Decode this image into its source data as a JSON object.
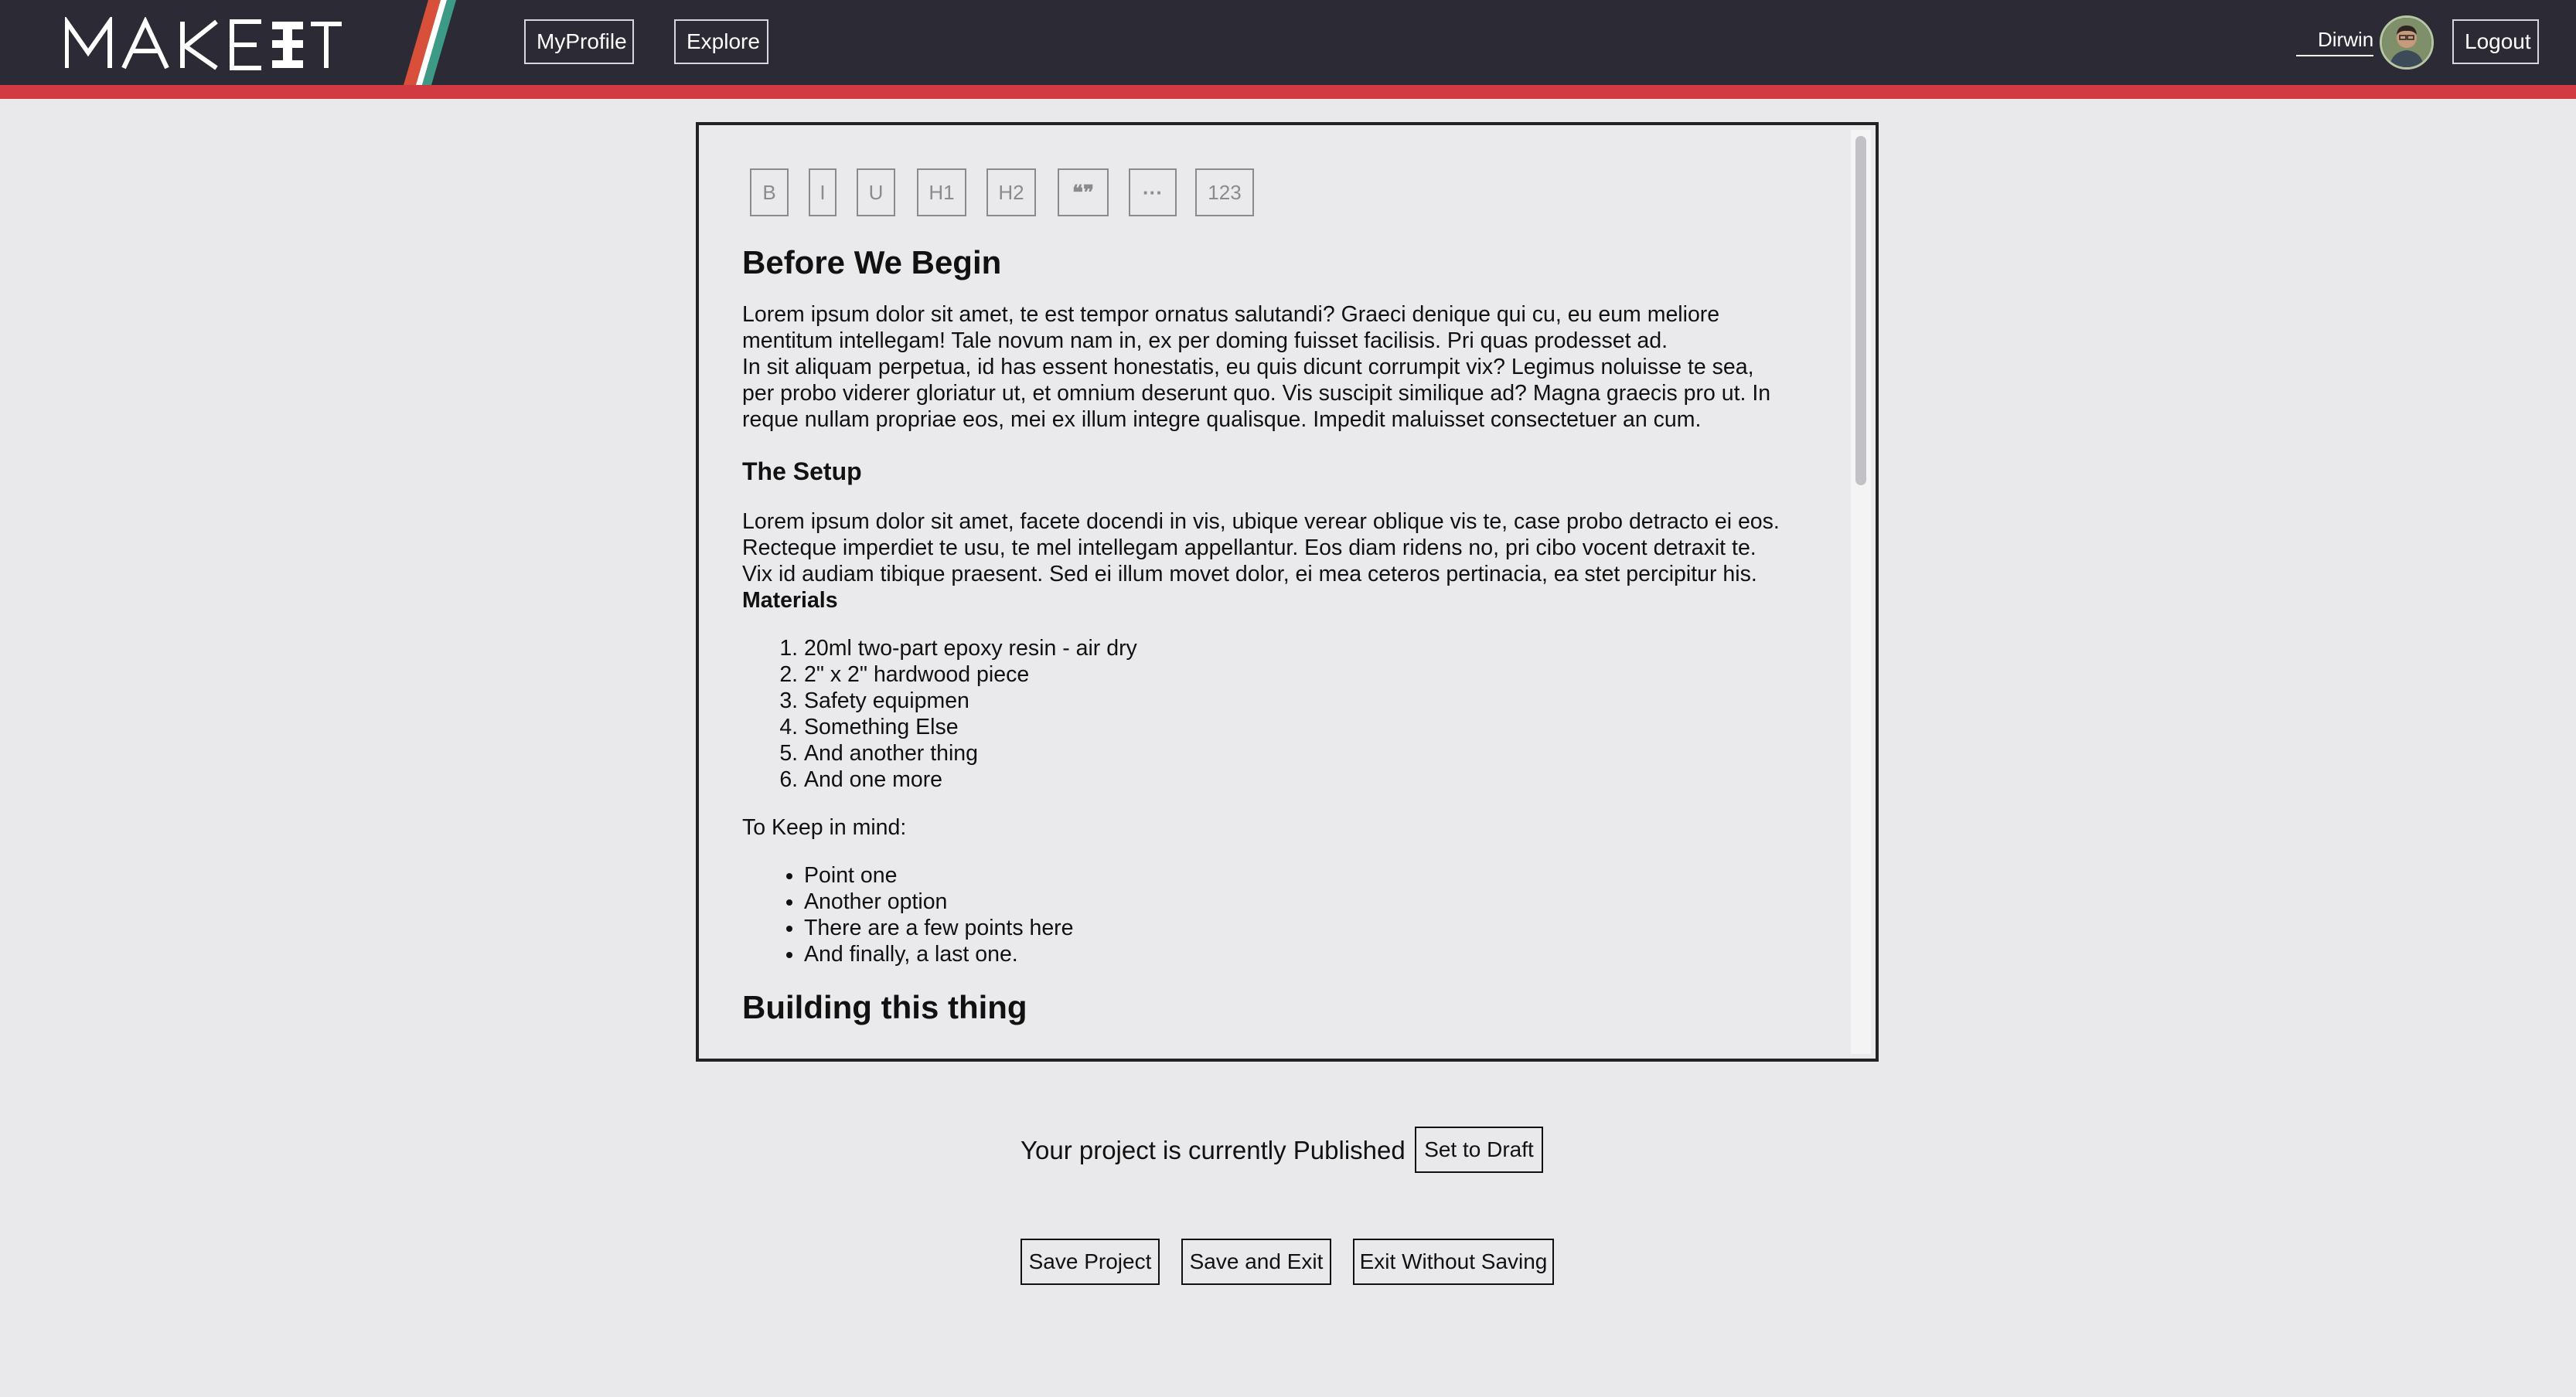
{
  "header": {
    "logo_text": "MAKEIT",
    "nav": {
      "my_profile": "MyProfile",
      "explore": "Explore"
    },
    "user": {
      "name": "Dirwin",
      "avatar_icon": "user-avatar"
    },
    "logout": "Logout",
    "colors": {
      "bar": "#2b2a35",
      "stripe": "#d03a40"
    }
  },
  "toolbar": {
    "bold": "B",
    "italic": "I",
    "underline": "U",
    "h1": "H1",
    "h2": "H2",
    "quote": "❝❞",
    "more": "···",
    "numbered": "123"
  },
  "document": {
    "heading1": "Before We Begin",
    "para1_line1": "Lorem ipsum dolor sit amet, te est tempor ornatus salutandi? Graeci denique qui cu, eu eum meliore",
    "para1_line2": "mentitum intellegam! Tale novum nam in, ex per doming fuisset facilisis. Pri quas prodesset ad.",
    "para1_line3": "In sit aliquam perpetua, id has essent honestatis, eu quis dicunt corrumpit vix? Legimus noluisse te sea,",
    "para1_line4": "per probo viderer gloriatur ut, et omnium deserunt quo. Vis suscipit similique ad? Magna graecis pro ut. In",
    "para1_line5": "reque nullam propriae eos, mei ex illum integre qualisque. Impedit maluisset consectetuer an cum.",
    "heading2": "The Setup",
    "para2_line1": "Lorem ipsum dolor sit amet, facete docendi in vis, ubique verear oblique vis te, case probo detracto ei eos.",
    "para2_line2": "Recteque imperdiet te usu, te mel intellegam appellantur. Eos diam ridens no, pri cibo vocent detraxit te.",
    "para2_line3": "Vix id audiam tibique praesent. Sed ei illum movet dolor, ei mea ceteros pertinacia, ea stet percipitur his.",
    "materials_label": "Materials",
    "materials": [
      "20ml two-part epoxy resin - air dry",
      "2\" x 2\" hardwood piece",
      "Safety equipmen",
      "Something Else",
      "And another thing",
      "And one more"
    ],
    "keep_in_mind": "To Keep in mind:",
    "points": [
      "Point one",
      "Another option",
      "There are a few points here",
      "And finally, a last one."
    ],
    "heading3": "Building this thing"
  },
  "status": {
    "text": "Your project is currently Published",
    "set_draft": "Set to Draft"
  },
  "actions": {
    "save": "Save Project",
    "save_exit": "Save and Exit",
    "exit": "Exit Without Saving"
  }
}
